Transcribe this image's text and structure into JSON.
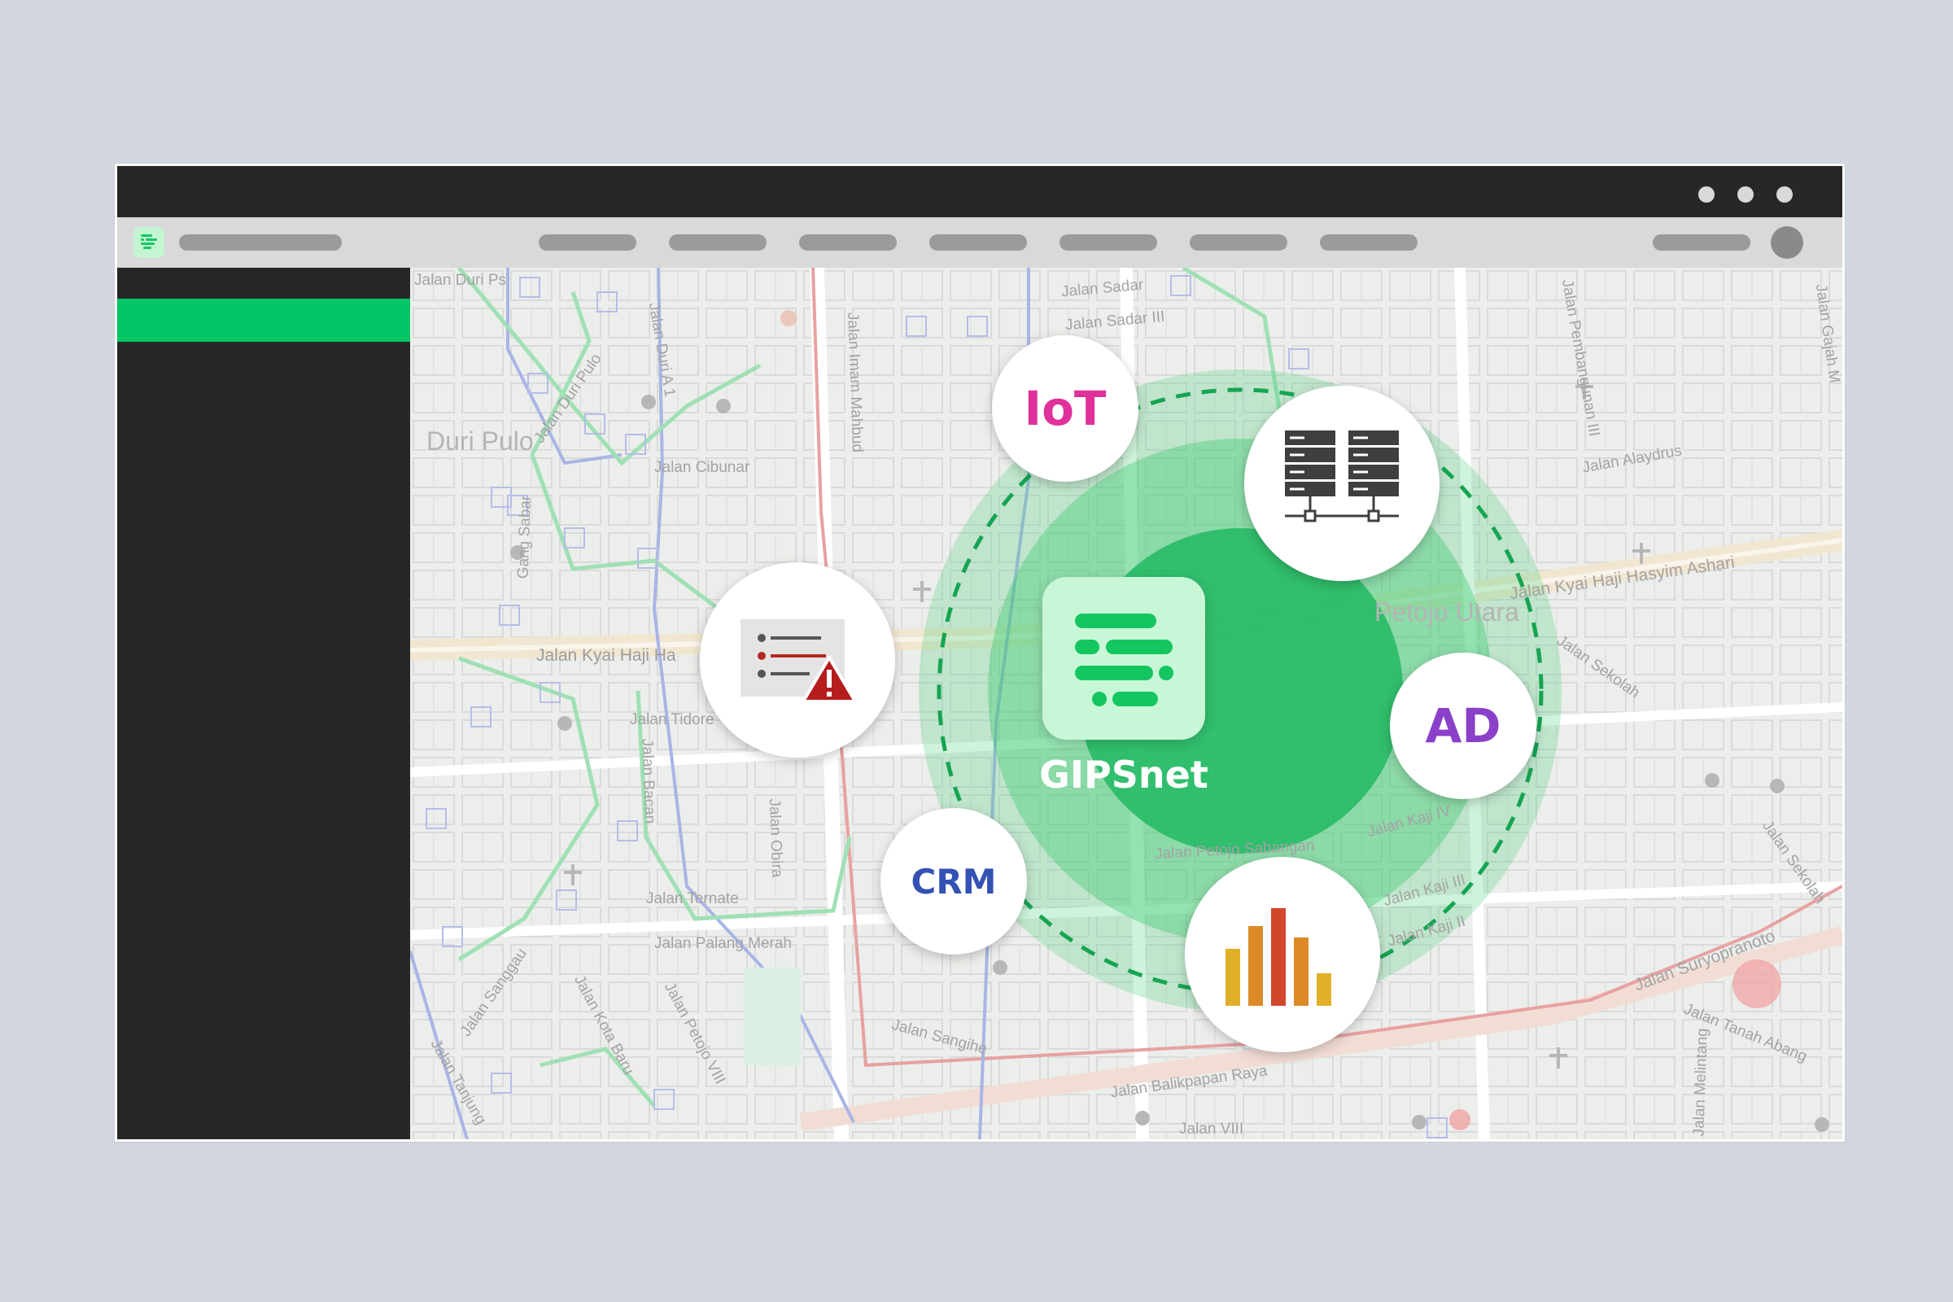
{
  "hub": {
    "name": "GIPSnet",
    "icon": "gipsnet-logo-icon"
  },
  "nodes": {
    "iot": {
      "label": "IoT",
      "color": "#e0309a"
    },
    "ad": {
      "label": "AD",
      "color": "#8a40c8"
    },
    "crm": {
      "label": "CRM",
      "color": "#3452b4"
    },
    "servers": {
      "icon": "server-network-icon"
    },
    "alerts": {
      "icon": "alert-list-icon"
    },
    "analytics": {
      "icon": "bar-chart-icon"
    }
  },
  "map": {
    "labels": {
      "duri_ps": "Jalan Duri Ps",
      "duri_pulo": "Duri Pulo",
      "jalan_duri_pulo": "Jalan Duri Pulo",
      "dun_a": "Jalan Duri A 1",
      "imam_mahbud": "Jalan Imam Mahbud",
      "cibunar": "Jalan Cibunar",
      "gang_sabar": "Gang Sabar",
      "kyai_haji_ha": "Jalan Kyai Haji Ha",
      "tidore": "Jalan Tidore",
      "bacan": "Jalan Bacan",
      "obira": "Jalan Obira",
      "ternate": "Jalan Ternate",
      "palang_merah": "Jalan Palang Merah",
      "sanggau": "Jalan Sanggau",
      "kota_baru": "Jalan Kota Baru",
      "petojo_vii": "Jalan Petojo VIII",
      "sangihe": "Jalan Sangihe",
      "balikpapan": "Jalan Balikpapan Raya",
      "petojo_utara": "Petojo Utara",
      "kyai_hasyim": "Jalan Kyai Haji Hasyim Ashari",
      "alaydrus": "Jalan Alaydrus",
      "pembangunan": "Jalan Pembangunan III",
      "sadar": "Jalan Sadar III",
      "sadar2": "Jalan Sadar",
      "sekolah": "Jalan Sekolah",
      "sekolah2": "Jalan Sekolah",
      "suryopranoto": "Jalan Suryopranoto",
      "tanah_abang": "Jalan Tanah Abang",
      "kaji_iii": "Jalan Kaji III",
      "kaji_ii": "Jalan Kaji II",
      "kaji_iv": "Jalan Kaji IV",
      "petojo_sabangan": "Jalan Petojo Sabangan",
      "gajah": "Jalan Gajah M",
      "melintang": "Jalan Melintang",
      "viii": "Jalan VIII",
      "tanjung": "Jalan Tanjung"
    }
  },
  "colors": {
    "page_bg": "#d2d6de",
    "titlebar": "#272727",
    "toolbar": "#d9d9d9",
    "sidebar": "#272727",
    "sidebar_active": "#00c565",
    "hub_green": "#2cc96e",
    "logo_green": "#13c660"
  }
}
